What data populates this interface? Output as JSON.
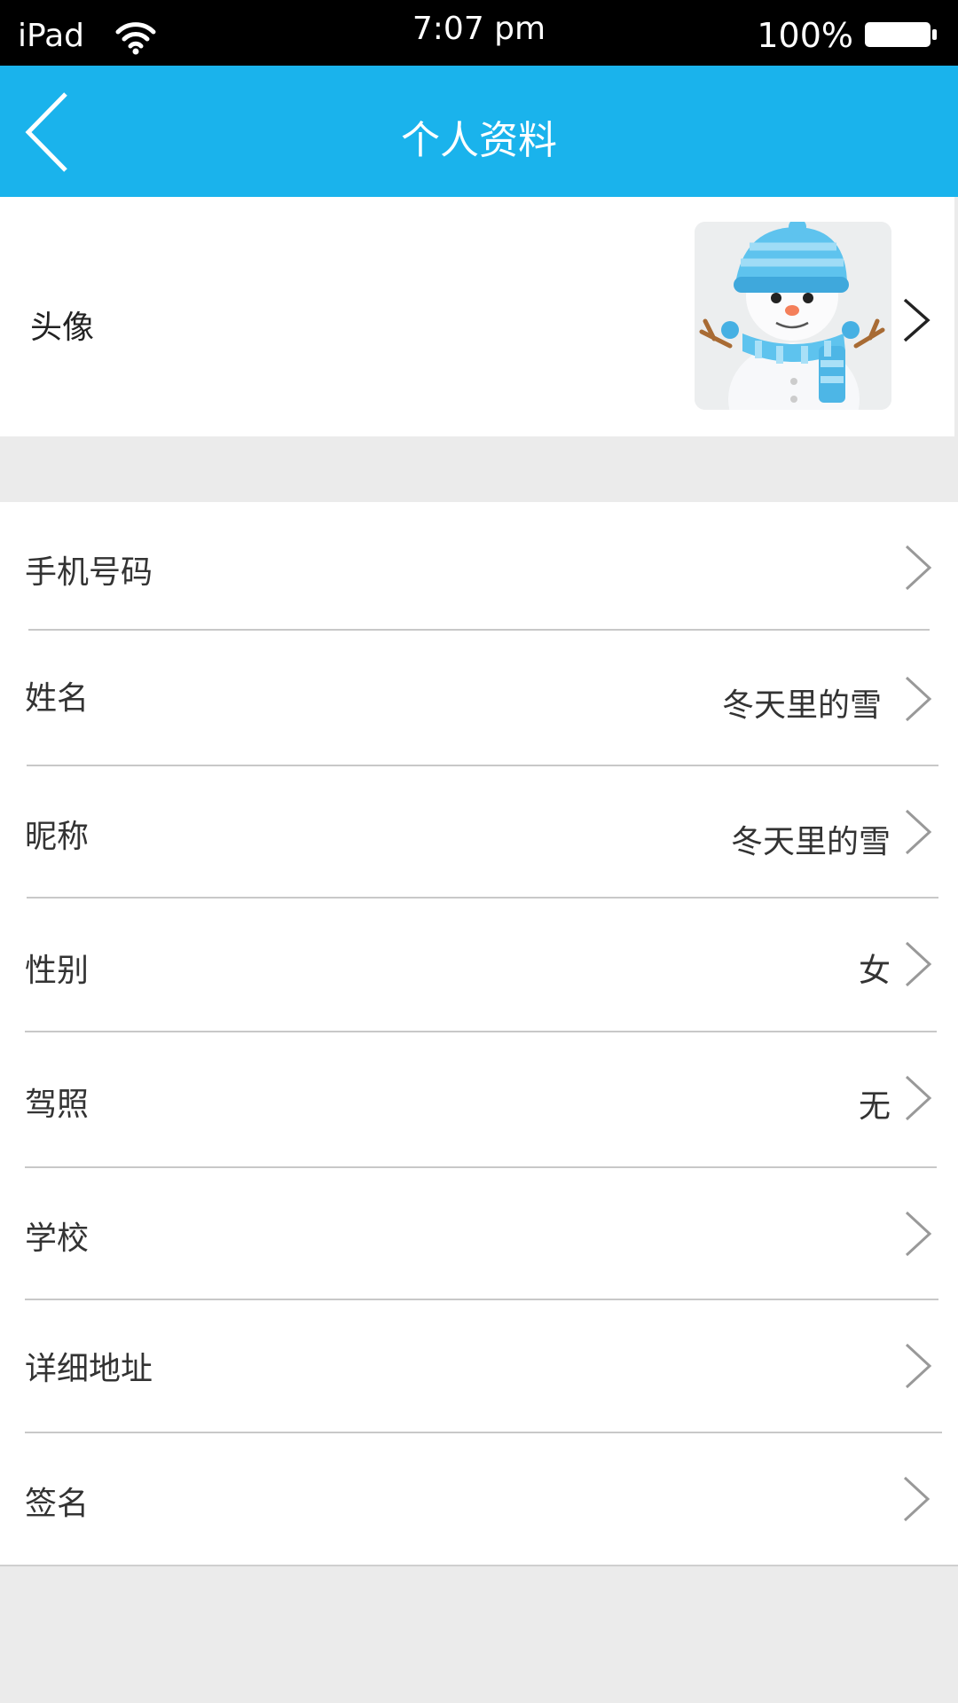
{
  "status_bar": {
    "device": "iPad",
    "time": "7:07 pm",
    "battery": "100%"
  },
  "nav": {
    "title": "个人资料"
  },
  "avatar": {
    "label": "头像"
  },
  "rows": [
    {
      "label": "手机号码",
      "value": ""
    },
    {
      "label": "姓名",
      "value": "冬天里的雪"
    },
    {
      "label": "昵称",
      "value": "冬天里的雪"
    },
    {
      "label": "性别",
      "value": "女"
    },
    {
      "label": "驾照",
      "value": "无"
    },
    {
      "label": "学校",
      "value": ""
    },
    {
      "label": "详细地址",
      "value": ""
    },
    {
      "label": "签名",
      "value": ""
    }
  ],
  "colors": {
    "accent": "#1ab3ec",
    "background": "#ebebeb"
  }
}
